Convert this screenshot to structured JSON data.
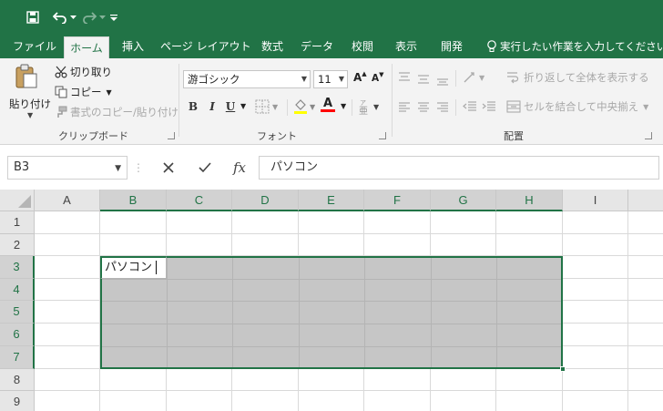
{
  "quick_access": {
    "save": "save-icon",
    "undo": "undo-icon",
    "redo": "redo-icon",
    "customize": "customize-qat-icon"
  },
  "tabs": [
    {
      "label": "ファイル",
      "active": false
    },
    {
      "label": "ホーム",
      "active": true
    },
    {
      "label": "挿入",
      "active": false
    },
    {
      "label": "ページ レイアウト",
      "active": false
    },
    {
      "label": "数式",
      "active": false
    },
    {
      "label": "データ",
      "active": false
    },
    {
      "label": "校閲",
      "active": false
    },
    {
      "label": "表示",
      "active": false
    },
    {
      "label": "開発",
      "active": false
    }
  ],
  "tell_me": "実行したい作業を入力してください",
  "clipboard": {
    "paste": "貼り付け",
    "cut": "切り取り",
    "copy": "コピー",
    "format_painter": "書式のコピー/貼り付け",
    "label": "クリップボード"
  },
  "font": {
    "name": "游ゴシック",
    "size": "11",
    "bold": "B",
    "italic": "I",
    "underline": "U",
    "label": "フォント",
    "fill_color": "#ffff00",
    "font_color": "#ff0000"
  },
  "alignment": {
    "wrap_text": "折り返して全体を表示する",
    "merge_center": "セルを結合して中央揃え",
    "label": "配置"
  },
  "formula_bar": {
    "name_box": "B3",
    "formula": "パソコン",
    "fx": "fx"
  },
  "grid": {
    "columns": [
      "A",
      "B",
      "C",
      "D",
      "E",
      "F",
      "G",
      "H",
      "I"
    ],
    "rows": [
      "1",
      "2",
      "3",
      "4",
      "5",
      "6",
      "7",
      "8",
      "9"
    ],
    "selected_columns": [
      "B",
      "C",
      "D",
      "E",
      "F",
      "G",
      "H"
    ],
    "selected_rows": [
      "3",
      "4",
      "5",
      "6",
      "7"
    ],
    "active_cell_ref": "B3",
    "active_cell_value": "パソコン"
  },
  "colors": {
    "accent": "#217346",
    "ribbon_bg": "#f3f3f3",
    "selection_fill": "#c6c6c6"
  }
}
